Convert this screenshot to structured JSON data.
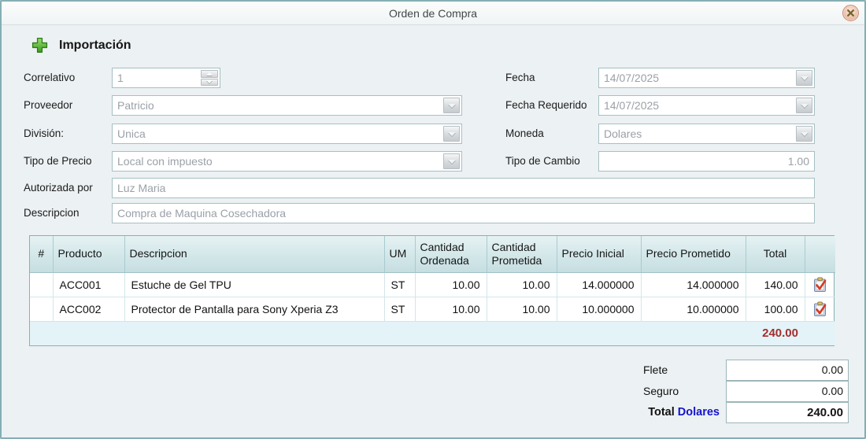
{
  "window": {
    "title": "Orden de Compra"
  },
  "section": {
    "title": "Importación"
  },
  "form": {
    "correlativo": {
      "label": "Correlativo",
      "value": "1"
    },
    "fecha": {
      "label": "Fecha",
      "value": "14/07/2025"
    },
    "proveedor": {
      "label": "Proveedor",
      "value": "Patricio"
    },
    "fecha_requerido": {
      "label": "Fecha Requerido",
      "value": "14/07/2025"
    },
    "division": {
      "label": "División:",
      "value": "Unica"
    },
    "moneda": {
      "label": "Moneda",
      "value": "Dolares"
    },
    "tipo_precio": {
      "label": "Tipo de Precio",
      "value": "Local con impuesto"
    },
    "tipo_cambio": {
      "label": "Tipo de Cambio",
      "value": "1.00"
    },
    "autorizada_por": {
      "label": "Autorizada por",
      "value": "Luz Maria"
    },
    "descripcion": {
      "label": "Descripcion",
      "value": "Compra de Maquina Cosechadora"
    }
  },
  "table": {
    "headers": [
      "#",
      "Producto",
      "Descripcion",
      "UM",
      "Cantidad Ordenada",
      "Cantidad Prometida",
      "Precio Inicial",
      "Precio Prometido",
      "Total",
      ""
    ],
    "rows": [
      {
        "num": "",
        "producto": "ACC001",
        "descripcion": "Estuche de Gel TPU",
        "um": "ST",
        "cantidad_ordenada": "10.00",
        "cantidad_prometida": "10.00",
        "precio_inicial": "14.000000",
        "precio_prometido": "14.000000",
        "total": "140.00"
      },
      {
        "num": "",
        "producto": "ACC002",
        "descripcion": "Protector de Pantalla para Sony Xperia Z3",
        "um": "ST",
        "cantidad_ordenada": "10.00",
        "cantidad_prometida": "10.00",
        "precio_inicial": "10.000000",
        "precio_prometido": "10.000000",
        "total": "100.00"
      }
    ],
    "footer_total": "240.00"
  },
  "totals": {
    "flete": {
      "label": "Flete",
      "value": "0.00"
    },
    "seguro": {
      "label": "Seguro",
      "value": "0.00"
    },
    "total": {
      "label": "Total",
      "currency": "Dolares",
      "value": "240.00"
    }
  },
  "icons": {
    "plus_icon": "green-plus",
    "close_icon": "x-in-circle",
    "row_action_icon": "clipboard-with-red-check",
    "dropdown_icon": "down-triangle",
    "spinner_icons": "up-down-triangles"
  },
  "colors": {
    "dialog_border": "#84afb4",
    "dialog_bg": "#ecf1f3",
    "table_header_bg": "#d3e7e9",
    "footer_bg": "#e4f3f8",
    "total_red": "#a42d2d",
    "currency_blue": "#1414cc",
    "plus_green": "#3d9a1f",
    "disabled_text": "#9aa1a8"
  }
}
